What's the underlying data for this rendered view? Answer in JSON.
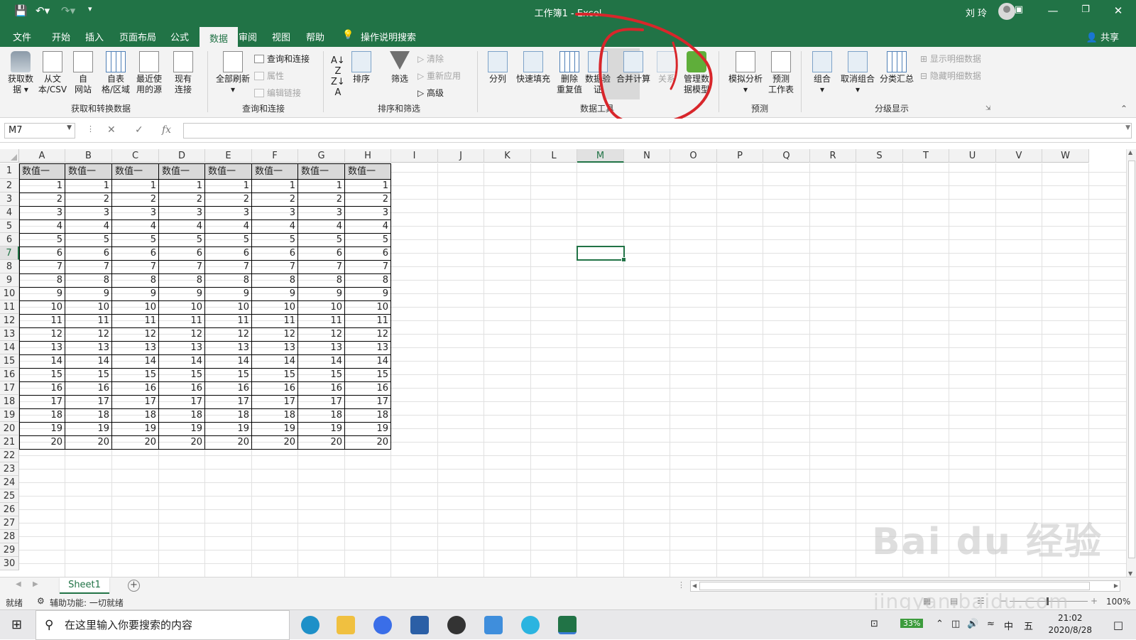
{
  "window": {
    "title": "工作簿1  -  Excel",
    "user": "刘 玲",
    "share": "共享"
  },
  "menu": [
    "文件",
    "开始",
    "插入",
    "页面布局",
    "公式",
    "数据",
    "审阅",
    "视图",
    "帮助"
  ],
  "menu_search": "操作说明搜索",
  "ribbon": {
    "get_data": "获取数\n据 ▾",
    "from_csv": "从文\n本/CSV",
    "from_web": "自\n网站",
    "from_table": "自表\n格/区域",
    "recent": "最近使\n用的源",
    "existing": "现有\n连接",
    "refresh_all": "全部刷新\n▾",
    "queries": "查询和连接",
    "properties": "属性",
    "edit_links": "编辑链接",
    "sort": "排序",
    "filter": "筛选",
    "clear": "清除",
    "reapply": "重新应用",
    "advanced": "高级",
    "text_to_col": "分列",
    "flash_fill": "快速填充",
    "remove_dup": "删除\n重复值",
    "validation": "数据验\n证",
    "consolidate": "合并计算",
    "relations": "关系",
    "data_model": "管理数\n据模型",
    "whatif": "模拟分析\n▾",
    "forecast": "预测\n工作表",
    "group": "组合\n▾",
    "ungroup": "取消组合\n▾",
    "subtotal": "分类汇总",
    "show_detail": "显示明细数据",
    "hide_detail": "隐藏明细数据",
    "groups": {
      "get": "获取和转换数据",
      "query": "查询和连接",
      "sort": "排序和筛选",
      "tools": "数据工具",
      "forecast": "预测",
      "outline": "分级显示"
    }
  },
  "namebox": "M7",
  "formula": "",
  "columns": [
    "A",
    "B",
    "C",
    "D",
    "E",
    "F",
    "G",
    "H",
    "I",
    "J",
    "K",
    "L",
    "M",
    "N",
    "O",
    "P",
    "Q",
    "R",
    "S",
    "T",
    "U",
    "V",
    "W"
  ],
  "rows": [
    "1",
    "2",
    "3",
    "4",
    "5",
    "6",
    "7",
    "8",
    "9",
    "10",
    "11",
    "12",
    "13",
    "14",
    "15",
    "16",
    "17",
    "18",
    "19",
    "20",
    "21",
    "22",
    "23",
    "24",
    "25",
    "26",
    "27",
    "28",
    "29",
    "30"
  ],
  "header_label": "数值一",
  "data_rows": [
    [
      1,
      1,
      1,
      1,
      1,
      1,
      1,
      1
    ],
    [
      2,
      2,
      2,
      2,
      2,
      2,
      2,
      2
    ],
    [
      3,
      3,
      3,
      3,
      3,
      3,
      3,
      3
    ],
    [
      4,
      4,
      4,
      4,
      4,
      4,
      4,
      4
    ],
    [
      5,
      5,
      5,
      5,
      5,
      5,
      5,
      5
    ],
    [
      6,
      6,
      6,
      6,
      6,
      6,
      6,
      6
    ],
    [
      7,
      7,
      7,
      7,
      7,
      7,
      7,
      7
    ],
    [
      8,
      8,
      8,
      8,
      8,
      8,
      8,
      8
    ],
    [
      9,
      9,
      9,
      9,
      9,
      9,
      9,
      9
    ],
    [
      10,
      10,
      10,
      10,
      10,
      10,
      10,
      10
    ],
    [
      11,
      11,
      11,
      11,
      11,
      11,
      11,
      11
    ],
    [
      12,
      12,
      12,
      12,
      12,
      12,
      12,
      12
    ],
    [
      13,
      13,
      13,
      13,
      13,
      13,
      13,
      13
    ],
    [
      14,
      14,
      14,
      14,
      14,
      14,
      14,
      14
    ],
    [
      15,
      15,
      15,
      15,
      15,
      15,
      15,
      15
    ],
    [
      16,
      16,
      16,
      16,
      16,
      16,
      16,
      16
    ],
    [
      17,
      17,
      17,
      17,
      17,
      17,
      17,
      17
    ],
    [
      18,
      18,
      18,
      18,
      18,
      18,
      18,
      18
    ],
    [
      19,
      19,
      19,
      19,
      19,
      19,
      19,
      19
    ],
    [
      20,
      20,
      20,
      20,
      20,
      20,
      20,
      20
    ]
  ],
  "sheet": {
    "name": "Sheet1"
  },
  "status": {
    "ready": "就绪",
    "accessibility": "辅助功能: 一切就绪",
    "zoom": "100%"
  },
  "taskbar": {
    "search_placeholder": "在这里输入你要搜索的内容",
    "battery": "33%",
    "ime": "中",
    "ime2": "五",
    "time": "21:02",
    "date": "2020/8/28"
  },
  "watermark": {
    "main": "Bai du 经验",
    "sub": "jingyan.baidu.com"
  },
  "colors": {
    "excel_green": "#217346",
    "highlight": "#d9d9d9",
    "annotation": "#d8262b"
  }
}
